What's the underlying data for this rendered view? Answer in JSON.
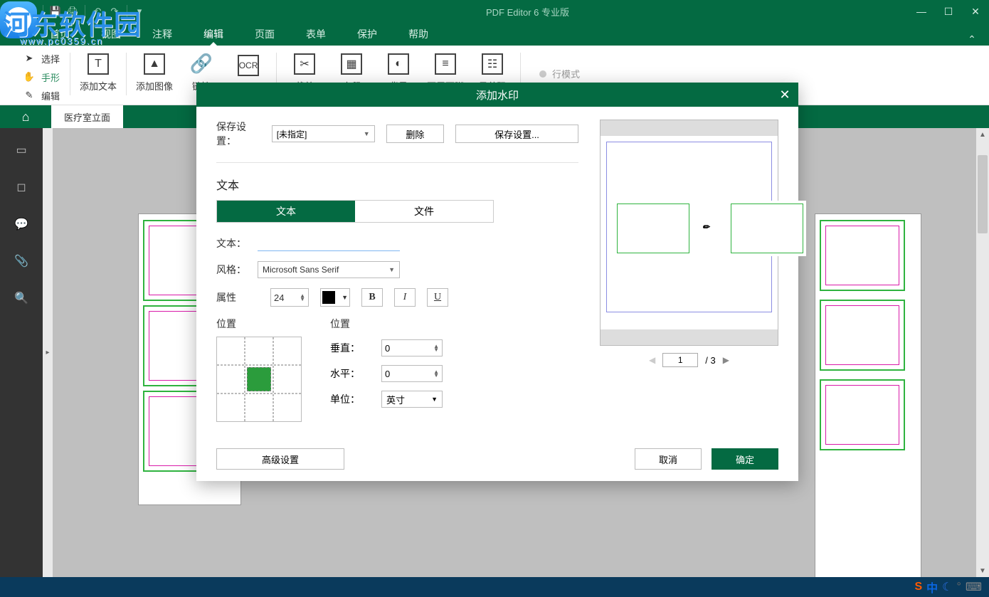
{
  "app": {
    "title": "PDF Editor 6 专业版"
  },
  "menubar": {
    "items": [
      "首页",
      "视图",
      "注释",
      "编辑",
      "页面",
      "表单",
      "保护",
      "帮助"
    ],
    "active_index": 3
  },
  "smalltools": {
    "select": "选择",
    "hand": "手形",
    "edit": "编辑"
  },
  "ribbon": {
    "addtext": "添加文本",
    "addimage": "添加图像",
    "link": "链接",
    "ocr": "OCR",
    "crop": "裁剪",
    "watermark": "水印",
    "background": "背景",
    "headerfooter": "页眉页脚",
    "bates": "贝茨码",
    "linemode": "行模式"
  },
  "doctab": "医疗室立面",
  "dialog": {
    "title": "添加水印",
    "save_label": "保存设置：",
    "save_value": "[未指定]",
    "delete": "删除",
    "savebtn": "保存设置...",
    "section_text": "文本",
    "tab_text": "文本",
    "tab_file": "文件",
    "text_label": "文本：",
    "text_value": "",
    "style_label": "风格：",
    "font_value": "Microsoft Sans Serif",
    "attr_label": "属性",
    "fontsize": "24",
    "pos_label": "位置",
    "pos2_label": "位置",
    "vertical": "垂直：",
    "horizontal": "水平：",
    "unit": "单位：",
    "vval": "0",
    "hval": "0",
    "unit_value": "英寸",
    "advanced": "高级设置",
    "cancel": "取消",
    "ok": "确定",
    "pager_current": "1",
    "pager_total": "/ 3"
  },
  "watermark": {
    "text": "河东软件园",
    "url": "www.pc0359.cn"
  },
  "ime": {
    "letter": "中"
  }
}
